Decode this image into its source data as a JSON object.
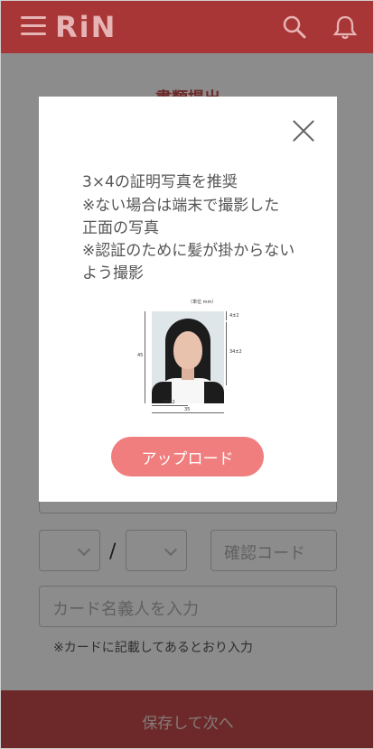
{
  "header": {
    "logo": "RiN",
    "menu_icon": "hamburger-menu-icon",
    "search_icon": "search-icon",
    "notification_icon": "bell-icon"
  },
  "page": {
    "title": "書類提出",
    "fields": {
      "security_code_placeholder": "確認コード",
      "cardholder_placeholder": "カード名義人を入力"
    },
    "expiry_separator": "/",
    "note": "※カードに記載してあるとおり入力",
    "save_button": "保存して次へ"
  },
  "modal": {
    "close_icon": "close-icon",
    "lines": [
      "3×4の証明写真を推奨",
      "※ない場合は端末で撮影した",
      "正面の写真",
      "※認証のために髪が掛からない",
      "よう撮影"
    ],
    "diagram": {
      "unit": "（単位 mm）",
      "top_margin": "4±2",
      "face_height": "34±2",
      "height": "45",
      "half_width": "17±2",
      "width": "35"
    },
    "upload_button": "アップロード"
  },
  "colors": {
    "header": "#a93636",
    "accent": "#c74c4c",
    "button": "#f07e7e"
  }
}
